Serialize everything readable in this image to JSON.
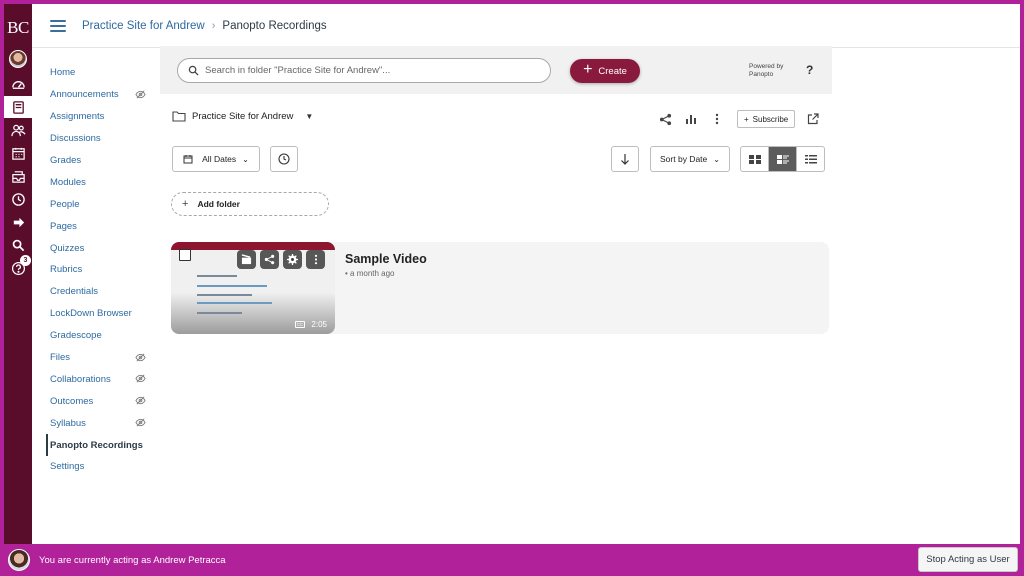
{
  "global_nav": {
    "brand": "BC",
    "items": [
      {
        "name": "account-avatar",
        "icon": "avatar"
      },
      {
        "name": "dashboard-icon",
        "icon": "dashboard"
      },
      {
        "name": "courses-icon",
        "icon": "book"
      },
      {
        "name": "groups-icon",
        "icon": "people"
      },
      {
        "name": "calendar-icon",
        "icon": "calendar"
      },
      {
        "name": "inbox-icon",
        "icon": "inbox"
      },
      {
        "name": "history-icon",
        "icon": "clock"
      },
      {
        "name": "commons-icon",
        "icon": "arrow-out"
      },
      {
        "name": "search-icon",
        "icon": "magnifier"
      },
      {
        "name": "help-icon",
        "icon": "question",
        "badge": "3"
      }
    ]
  },
  "header": {
    "breadcrumb_course": "Practice Site for Andrew",
    "breadcrumb_separator": "›",
    "breadcrumb_current": "Panopto Recordings"
  },
  "course_nav": {
    "items": [
      {
        "label": "Home",
        "hidden": false
      },
      {
        "label": "Announcements",
        "hidden": true
      },
      {
        "label": "Assignments",
        "hidden": false
      },
      {
        "label": "Discussions",
        "hidden": false
      },
      {
        "label": "Grades",
        "hidden": false
      },
      {
        "label": "Modules",
        "hidden": false
      },
      {
        "label": "People",
        "hidden": false
      },
      {
        "label": "Pages",
        "hidden": false
      },
      {
        "label": "Quizzes",
        "hidden": false
      },
      {
        "label": "Rubrics",
        "hidden": false
      },
      {
        "label": "Credentials",
        "hidden": false
      },
      {
        "label": "LockDown Browser",
        "hidden": false
      },
      {
        "label": "Gradescope",
        "hidden": false
      },
      {
        "label": "Files",
        "hidden": true
      },
      {
        "label": "Collaborations",
        "hidden": true
      },
      {
        "label": "Outcomes",
        "hidden": true
      },
      {
        "label": "Syllabus",
        "hidden": true
      },
      {
        "label": "Panopto Recordings",
        "hidden": false,
        "active": true
      },
      {
        "label": "Settings",
        "hidden": false
      }
    ]
  },
  "panopto": {
    "search_placeholder": "Search in folder \"Practice Site for Andrew\"...",
    "create_label": "Create",
    "powered_by_line1": "Powered by",
    "powered_by_line2": "Panopto",
    "help_label": "?",
    "folder_name": "Practice Site for Andrew",
    "subscribe_label": "Subscribe",
    "date_filter": "All Dates",
    "sort_label": "Sort by Date",
    "add_folder_label": "Add folder",
    "videos": [
      {
        "title": "Sample Video",
        "date": "a month ago",
        "duration": "2:05"
      }
    ]
  },
  "masquerade": {
    "message": "You are currently acting as Andrew Petracca",
    "stop_label": "Stop Acting as User"
  },
  "colors": {
    "masquerade_bg": "#b0219a",
    "global_nav_bg": "#5a0d2b",
    "create_button": "#8a1a3d",
    "link": "#2d6aa0"
  }
}
